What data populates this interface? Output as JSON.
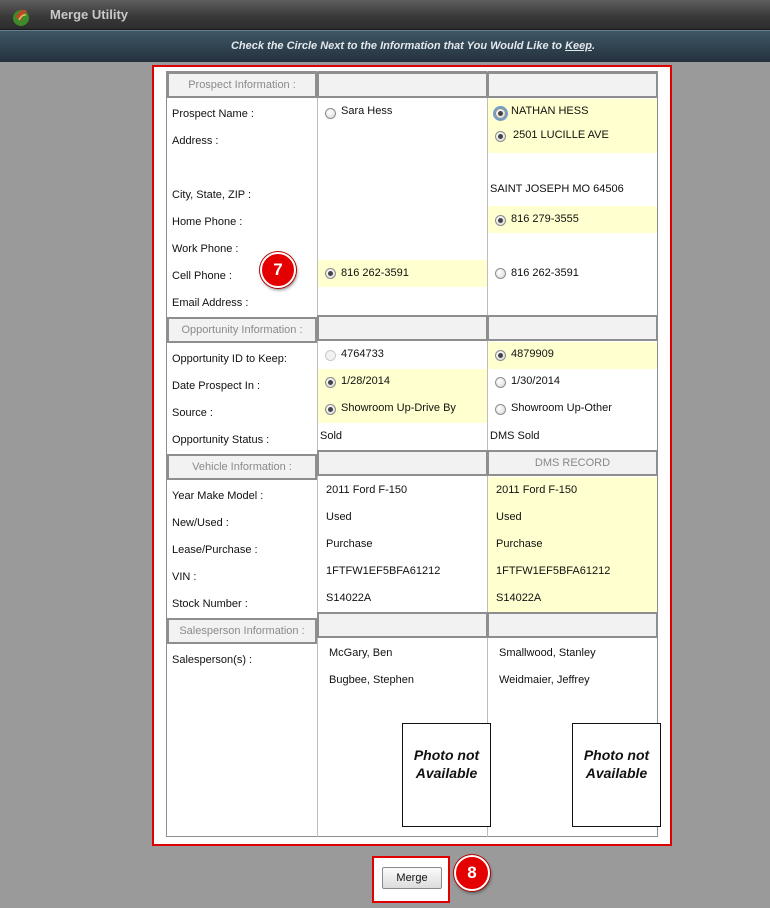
{
  "app": {
    "title": "Merge Utility"
  },
  "instruction": {
    "text": "Check the Circle Next to the Information that You Would Like to ",
    "keyword": "Keep",
    "end": "."
  },
  "sections": {
    "prospect": "Prospect Information :",
    "opportunity": "Opportunity Information :",
    "vehicle": "Vehicle Information :",
    "salesperson": "Salesperson Information :"
  },
  "labels": {
    "prospect_name": "Prospect Name :",
    "address": "Address :",
    "city_state_zip": "City, State, ZIP :",
    "home_phone": "Home Phone :",
    "work_phone": "Work Phone :",
    "cell_phone": "Cell Phone :",
    "email": "Email Address :",
    "opp_id": "Opportunity ID to Keep:",
    "date_in": "Date Prospect In :",
    "source": "Source :",
    "opp_status": "Opportunity Status :",
    "ymm": "Year Make Model :",
    "new_used": "New/Used :",
    "lease_purchase": "Lease/Purchase :",
    "vin": "VIN :",
    "stock": "Stock Number :",
    "salespersons": "Salesperson(s) :"
  },
  "left": {
    "prospect_name": "Sara Hess",
    "cell_phone": "816 262-3591",
    "opp_id": "4764733",
    "date_in": "1/28/2014",
    "source": "Showroom Up-Drive By",
    "opp_status": "Sold",
    "ymm": "2011 Ford F-150",
    "new_used": "Used",
    "lease_purchase": "Purchase",
    "vin": "1FTFW1EF5BFA61212",
    "stock": "S14022A",
    "sales1": "McGary, Ben",
    "sales2": "Bugbee, Stephen",
    "photo": "Photo not Available"
  },
  "right": {
    "prospect_name": "NATHAN HESS",
    "address": "2501 LUCILLE AVE",
    "city_state_zip": "SAINT JOSEPH MO 64506",
    "home_phone": "816 279-3555",
    "cell_phone": "816 262-3591",
    "opp_id": "4879909",
    "date_in": "1/30/2014",
    "source": "Showroom Up-Other",
    "opp_status": "DMS Sold",
    "vehicle_header": "DMS RECORD",
    "ymm": "2011 Ford F-150",
    "new_used": "Used",
    "lease_purchase": "Purchase",
    "vin": "1FTFW1EF5BFA61212",
    "stock": "S14022A",
    "sales1": "Smallwood, Stanley",
    "sales2": "Weidmaier, Jeffrey",
    "photo": "Photo not Available"
  },
  "badges": {
    "step7": "7",
    "step8": "8"
  },
  "merge_button": {
    "label": "Merge"
  },
  "colors": {
    "highlight": "#ffffcf",
    "callout": "#e40000"
  }
}
